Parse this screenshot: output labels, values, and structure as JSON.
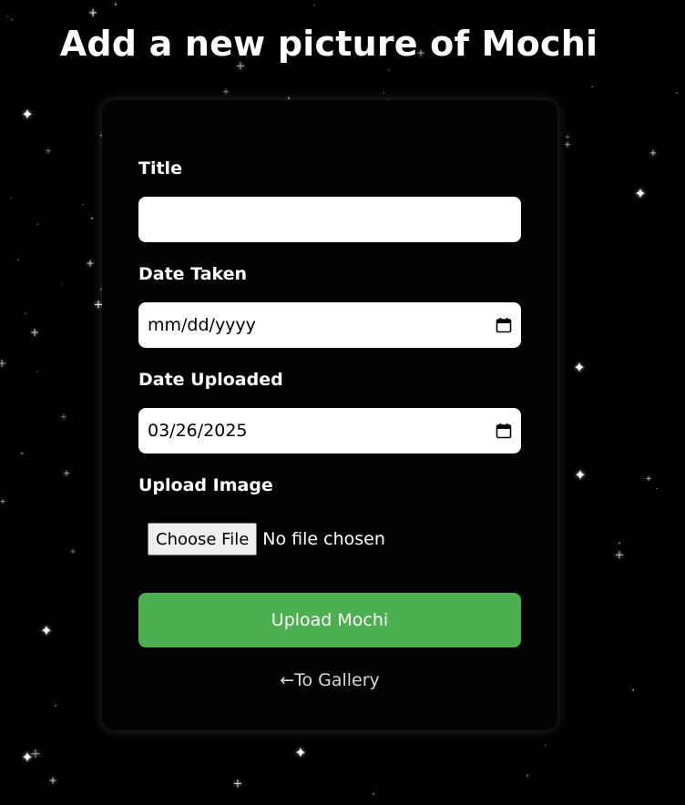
{
  "page": {
    "title": "Add a new picture of Mochi"
  },
  "form": {
    "title_label": "Title",
    "title_value": "",
    "date_taken_label": "Date Taken",
    "date_taken_value": "mm/dd/yyyy",
    "date_uploaded_label": "Date Uploaded",
    "date_uploaded_value": "03/26/2025",
    "upload_image_label": "Upload Image",
    "choose_file_label": "Choose File",
    "file_status": "No file chosen",
    "submit_label": "Upload Mochi",
    "back_link": "←To Gallery"
  },
  "colors": {
    "background": "#000000",
    "submit": "#4caf50"
  },
  "icons": {
    "date_picker": "calendar-icon"
  }
}
